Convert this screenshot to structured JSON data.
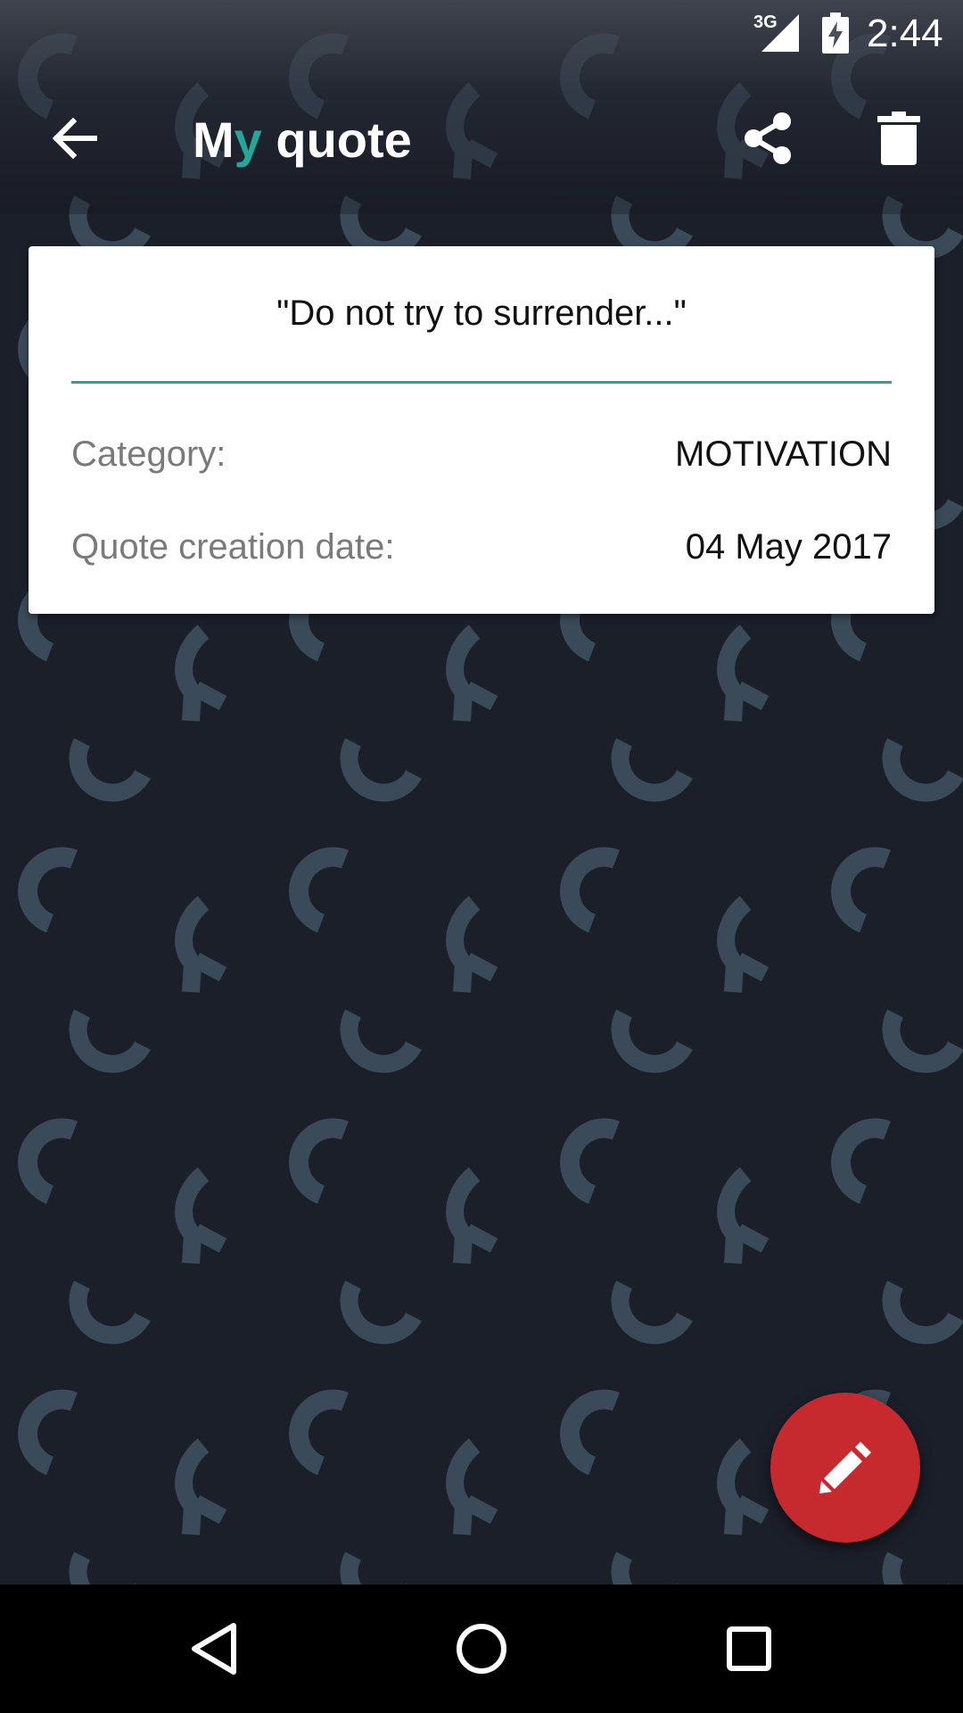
{
  "status_bar": {
    "network_type": "3G",
    "time": "2:44",
    "signal_icon": "signal-icon",
    "battery_icon": "battery-charging-icon"
  },
  "toolbar": {
    "title_first": "M",
    "title_accent": "y",
    "title_rest": " quote",
    "back_icon": "arrow-back-icon",
    "share_icon": "share-icon",
    "delete_icon": "trash-icon"
  },
  "quote_card": {
    "quote": "\"Do not try to surrender...\"",
    "category_label": "Category:",
    "category_value": "MOTIVATION",
    "date_label": "Quote creation date:",
    "date_value": "04 May 2017"
  },
  "fab": {
    "icon": "pencil-icon"
  },
  "nav_bar": {
    "back_icon": "nav-back-icon",
    "home_icon": "nav-home-icon",
    "recents_icon": "nav-recents-icon"
  },
  "colors": {
    "background": "#1b1f2a",
    "accent": "#26a69a",
    "fab": "#c62a2f",
    "pattern": "#3a4a59"
  }
}
